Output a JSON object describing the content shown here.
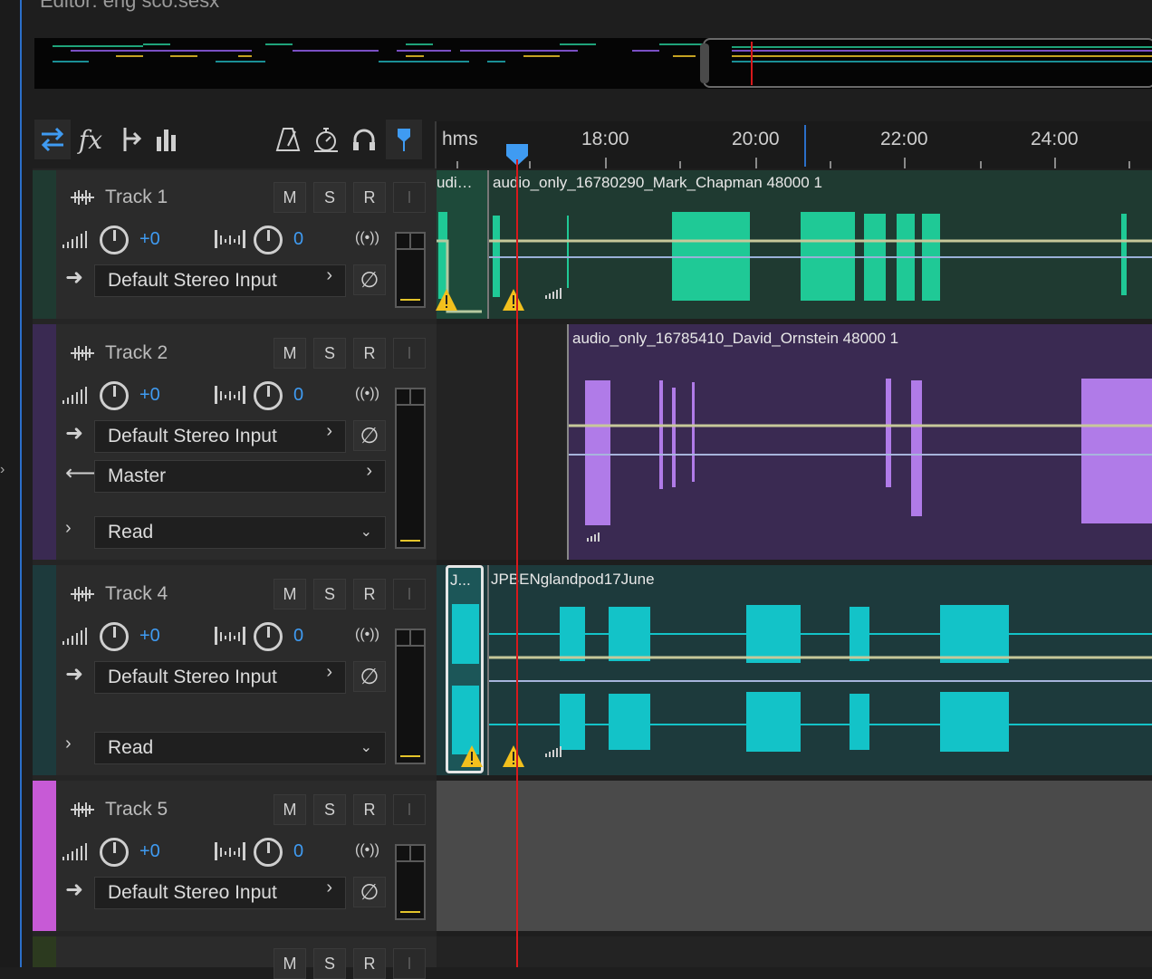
{
  "window": {
    "title": "Editor: eng sco.sesx"
  },
  "toolbar": {
    "buttons": [
      "switch-view",
      "fx",
      "sends",
      "eq",
      "metronome",
      "timer",
      "headphones",
      "pin"
    ]
  },
  "ruler": {
    "unit_label": "hms",
    "ticks": [
      "18:00",
      "20:00",
      "22:00",
      "24:00"
    ]
  },
  "colors": {
    "track1": "#1f3a31",
    "track2": "#3a2a52",
    "track4": "#1d3a3c",
    "track5": "#c75ad6",
    "clip1_wave": "#1fc996",
    "clip2_wave": "#b07be8",
    "clip4_wave": "#13c3c8",
    "playhead": "#d7191c",
    "value_blue": "#3f9bf2"
  },
  "tracks": [
    {
      "name": "Track 1",
      "volume": "+0",
      "pan": "0",
      "buttons": {
        "mute": "M",
        "solo": "S",
        "record": "R",
        "input": "I"
      },
      "input": "Default Stereo Input",
      "clips": [
        {
          "label": "udi…"
        },
        {
          "label": "audio_only_16780290_Mark_Chapman 48000 1"
        }
      ]
    },
    {
      "name": "Track 2",
      "volume": "+0",
      "pan": "0",
      "buttons": {
        "mute": "M",
        "solo": "S",
        "record": "R",
        "input": "I"
      },
      "input": "Default Stereo Input",
      "output": "Master",
      "automation": "Read",
      "clips": [
        {
          "label": "audio_only_16785410_David_Ornstein 48000 1"
        }
      ]
    },
    {
      "name": "Track 4",
      "volume": "+0",
      "pan": "0",
      "buttons": {
        "mute": "M",
        "solo": "S",
        "record": "R",
        "input": "I"
      },
      "input": "Default Stereo Input",
      "automation": "Read",
      "clips": [
        {
          "label": "J..."
        },
        {
          "label": "JPBENglandpod17June"
        }
      ]
    },
    {
      "name": "Track 5",
      "volume": "+0",
      "pan": "0",
      "buttons": {
        "mute": "M",
        "solo": "S",
        "record": "R",
        "input": "I"
      },
      "input": "Default Stereo Input",
      "clips": []
    },
    {
      "name": "",
      "buttons": {
        "mute": "M",
        "solo": "S",
        "record": "R",
        "input": "I"
      }
    }
  ]
}
